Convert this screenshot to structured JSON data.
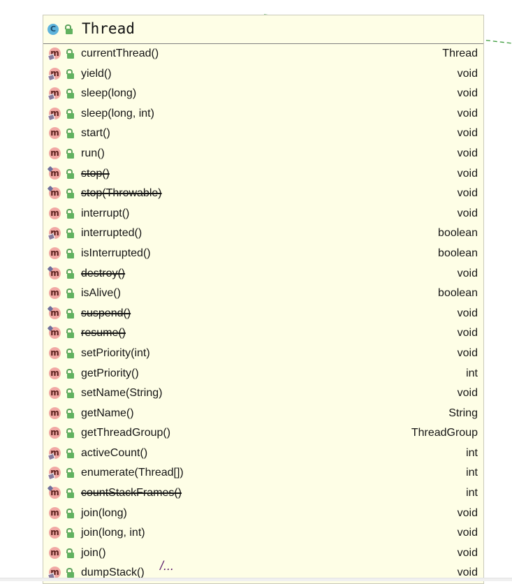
{
  "class": {
    "title": "Thread",
    "kind_icon": "C",
    "colors": {
      "card_bg": "#fefee6",
      "class_icon": "#5fb4dc",
      "method_icon": "#f1a8a4",
      "lock": "#61b260",
      "connector": "#3a9a3a"
    }
  },
  "method_icon_label": "m",
  "methods": [
    {
      "name": "currentThread()",
      "type": "Thread",
      "static": true,
      "deprecated": false
    },
    {
      "name": "yield()",
      "type": "void",
      "static": true,
      "deprecated": false
    },
    {
      "name": "sleep(long)",
      "type": "void",
      "static": true,
      "deprecated": false
    },
    {
      "name": "sleep(long, int)",
      "type": "void",
      "static": true,
      "deprecated": false
    },
    {
      "name": "start()",
      "type": "void",
      "static": false,
      "deprecated": false
    },
    {
      "name": "run()",
      "type": "void",
      "static": false,
      "deprecated": false
    },
    {
      "name": "stop()",
      "type": "void",
      "static": false,
      "deprecated": true
    },
    {
      "name": "stop(Throwable)",
      "type": "void",
      "static": false,
      "deprecated": true
    },
    {
      "name": "interrupt()",
      "type": "void",
      "static": false,
      "deprecated": false
    },
    {
      "name": "interrupted()",
      "type": "boolean",
      "static": true,
      "deprecated": false
    },
    {
      "name": "isInterrupted()",
      "type": "boolean",
      "static": false,
      "deprecated": false
    },
    {
      "name": "destroy()",
      "type": "void",
      "static": false,
      "deprecated": true
    },
    {
      "name": "isAlive()",
      "type": "boolean",
      "static": false,
      "deprecated": false
    },
    {
      "name": "suspend()",
      "type": "void",
      "static": false,
      "deprecated": true
    },
    {
      "name": "resume()",
      "type": "void",
      "static": false,
      "deprecated": true
    },
    {
      "name": "setPriority(int)",
      "type": "void",
      "static": false,
      "deprecated": false
    },
    {
      "name": "getPriority()",
      "type": "int",
      "static": false,
      "deprecated": false
    },
    {
      "name": "setName(String)",
      "type": "void",
      "static": false,
      "deprecated": false
    },
    {
      "name": "getName()",
      "type": "String",
      "static": false,
      "deprecated": false
    },
    {
      "name": "getThreadGroup()",
      "type": "ThreadGroup",
      "static": false,
      "deprecated": false
    },
    {
      "name": "activeCount()",
      "type": "int",
      "static": true,
      "deprecated": false
    },
    {
      "name": "enumerate(Thread[])",
      "type": "int",
      "static": true,
      "deprecated": false
    },
    {
      "name": "countStackFrames()",
      "type": "int",
      "static": false,
      "deprecated": true
    },
    {
      "name": "join(long)",
      "type": "void",
      "static": false,
      "deprecated": false
    },
    {
      "name": "join(long, int)",
      "type": "void",
      "static": false,
      "deprecated": false
    },
    {
      "name": "join()",
      "type": "void",
      "static": false,
      "deprecated": false
    },
    {
      "name": "dumpStack()",
      "type": "void",
      "static": true,
      "deprecated": false
    }
  ],
  "overflow_indicator": "/..."
}
